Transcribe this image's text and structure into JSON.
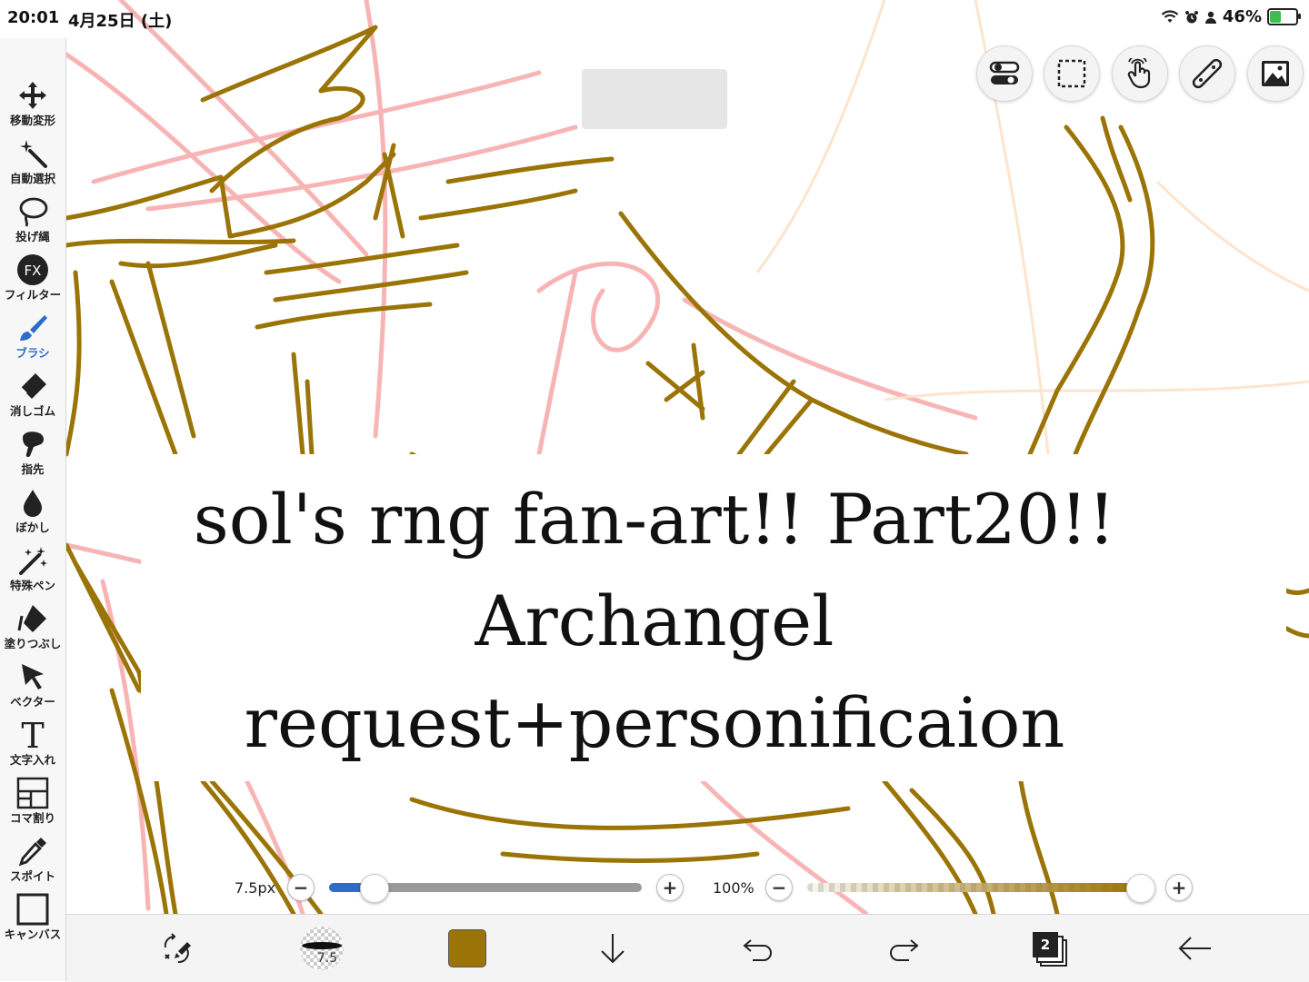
{
  "status_bar": {
    "time": "20:01",
    "date": "4月25日 (土)",
    "battery": "46%",
    "battery_level": 0.46
  },
  "toolbar": {
    "tools": [
      {
        "label": "移動変形",
        "icon": "move-arrows-icon"
      },
      {
        "label": "自動選択",
        "icon": "magic-wand-icon"
      },
      {
        "label": "投げ縄",
        "icon": "lasso-icon"
      },
      {
        "label": "フィルター",
        "icon": "fx-filter-icon"
      },
      {
        "label": "ブラシ",
        "icon": "brush-icon",
        "active": true
      },
      {
        "label": "消しゴム",
        "icon": "eraser-icon"
      },
      {
        "label": "指先",
        "icon": "finger-smudge-icon"
      },
      {
        "label": "ぼかし",
        "icon": "blur-drop-icon"
      },
      {
        "label": "特殊ペン",
        "icon": "special-pen-icon"
      },
      {
        "label": "塗りつぶし",
        "icon": "fill-bucket-icon"
      },
      {
        "label": "ベクター",
        "icon": "vector-cursor-icon"
      },
      {
        "label": "文字入れ",
        "icon": "text-t-icon"
      },
      {
        "label": "コマ割り",
        "icon": "panel-split-icon"
      },
      {
        "label": "スポイト",
        "icon": "eyedropper-icon"
      },
      {
        "label": "キャンバス",
        "icon": "canvas-icon"
      }
    ]
  },
  "canvas": {
    "title_lines": [
      "sol's rng fan-art!! Part20!!",
      "Archangel",
      "request+personificaion"
    ],
    "ghost_button_label": "",
    "stroke_color": "#9a7406",
    "sketch_color": "#f7a8a8"
  },
  "top_buttons": [
    "toggle-icon",
    "selection-icon",
    "touch-icon",
    "ruler-icon",
    "image-icon"
  ],
  "brush_size": {
    "label": "7.5px",
    "minus": "−",
    "plus": "+",
    "level": 0.1
  },
  "opacity": {
    "label": "100%",
    "minus": "−",
    "plus": "+",
    "level": 1.0
  },
  "bottom_bar": {
    "brush_preview_size": "7.5",
    "current_color": "#9a7406",
    "layer_count": "2",
    "icons": [
      "transform-swap-icon",
      "brush-preview-icon",
      "color-swatch",
      "download-arrow-icon",
      "undo-icon",
      "redo-icon",
      "layers-icon",
      "back-arrow-icon"
    ]
  }
}
